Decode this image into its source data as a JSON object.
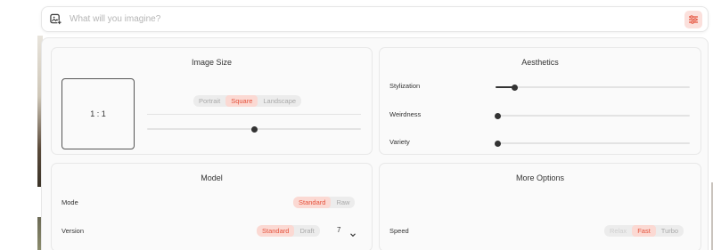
{
  "search": {
    "placeholder": "What will you imagine?",
    "value": ""
  },
  "image_size": {
    "title": "Image Size",
    "aspect_label": "1 : 1",
    "options": [
      "Portrait",
      "Square",
      "Landscape"
    ],
    "selected": "Square",
    "slider_fraction": 0.5
  },
  "aesthetics": {
    "title": "Aesthetics",
    "sliders": [
      {
        "label": "Stylization",
        "value_fraction": 0.1
      },
      {
        "label": "Weirdness",
        "value_fraction": 0.0
      },
      {
        "label": "Variety",
        "value_fraction": 0.0
      }
    ]
  },
  "model": {
    "title": "Model",
    "mode_label": "Mode",
    "mode_options": [
      "Standard",
      "Raw"
    ],
    "mode_selected": "Standard",
    "version_label": "Version",
    "version_options": [
      "Standard",
      "Draft"
    ],
    "version_selected": "Standard",
    "version_number": "7"
  },
  "more_options": {
    "title": "More Options",
    "speed_label": "Speed",
    "speed_options": [
      "Relax",
      "Fast",
      "Turbo"
    ],
    "speed_selected": "Fast"
  },
  "colors": {
    "accent": "#e5533d",
    "accent_bg": "#fbd9d3"
  },
  "icons": {
    "image_add": "image-plus-icon",
    "settings": "sliders-icon",
    "chevron": "chevron-down-icon"
  }
}
